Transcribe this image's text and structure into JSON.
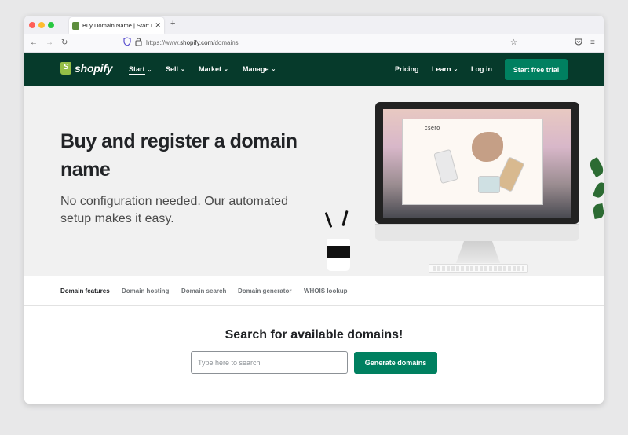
{
  "browser": {
    "tab_title": "Buy Domain Name | Start Doma",
    "tab_close_glyph": "✕",
    "new_tab_glyph": "+",
    "url_prefix": "https://www.",
    "url_host": "shopify.com",
    "url_path": "/domains"
  },
  "site_nav": {
    "logo_text": "shopify",
    "items": [
      {
        "label": "Start",
        "active": true
      },
      {
        "label": "Sell"
      },
      {
        "label": "Market"
      },
      {
        "label": "Manage"
      }
    ],
    "right_items": [
      {
        "label": "Pricing"
      },
      {
        "label": "Learn"
      },
      {
        "label": "Log in"
      }
    ],
    "cta_label": "Start free trial",
    "colors": {
      "nav_bg": "#063a2b",
      "cta_bg": "#008060",
      "logo_green": "#95bf47"
    }
  },
  "hero": {
    "title": "Buy and register a domain name",
    "subtitle": "No configuration needed. Our automated setup makes it easy.",
    "screen_brand": "csero"
  },
  "sub_nav": {
    "items": [
      {
        "label": "Domain features",
        "active": true
      },
      {
        "label": "Domain hosting"
      },
      {
        "label": "Domain search"
      },
      {
        "label": "Domain generator"
      },
      {
        "label": "WHOIS lookup"
      }
    ]
  },
  "search": {
    "title": "Search for available domains!",
    "placeholder": "Type here to search",
    "value": "",
    "button_label": "Generate domains"
  }
}
